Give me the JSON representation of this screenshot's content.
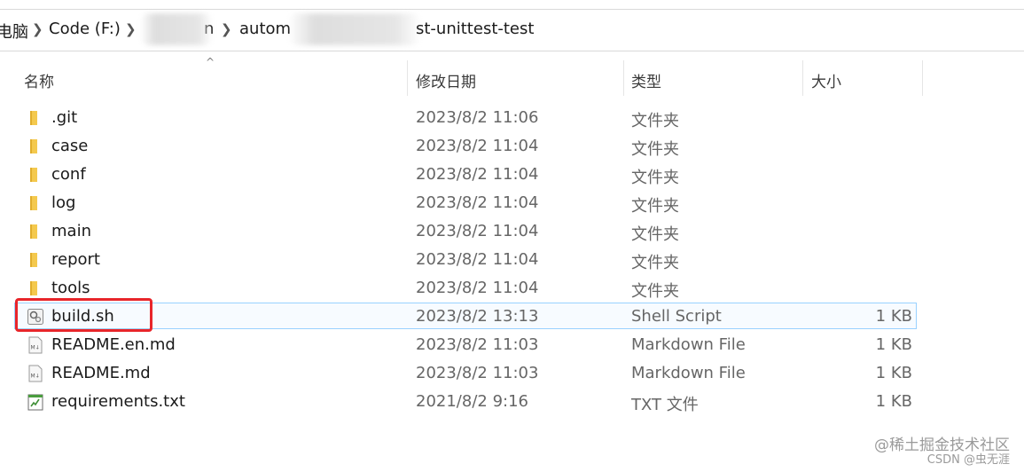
{
  "breadcrumb": {
    "items": [
      "电脑",
      "Code (F:)",
      "n",
      "autom",
      "st-unittest-test"
    ]
  },
  "columns": {
    "name": "名称",
    "date": "修改日期",
    "type": "类型",
    "size": "大小"
  },
  "files": [
    {
      "name": ".git",
      "date": "2023/8/2 11:06",
      "type": "文件夹",
      "size": "",
      "icon": "folder-icon"
    },
    {
      "name": "case",
      "date": "2023/8/2 11:04",
      "type": "文件夹",
      "size": "",
      "icon": "folder-icon"
    },
    {
      "name": "conf",
      "date": "2023/8/2 11:04",
      "type": "文件夹",
      "size": "",
      "icon": "folder-icon"
    },
    {
      "name": "log",
      "date": "2023/8/2 11:04",
      "type": "文件夹",
      "size": "",
      "icon": "folder-icon"
    },
    {
      "name": "main",
      "date": "2023/8/2 11:04",
      "type": "文件夹",
      "size": "",
      "icon": "folder-icon"
    },
    {
      "name": "report",
      "date": "2023/8/2 11:04",
      "type": "文件夹",
      "size": "",
      "icon": "folder-icon"
    },
    {
      "name": "tools",
      "date": "2023/8/2 11:04",
      "type": "文件夹",
      "size": "",
      "icon": "folder-icon"
    },
    {
      "name": "build.sh",
      "date": "2023/8/2 13:13",
      "type": "Shell Script",
      "size": "1 KB",
      "icon": "shell-script-icon"
    },
    {
      "name": "README.en.md",
      "date": "2023/8/2 11:03",
      "type": "Markdown File",
      "size": "1 KB",
      "icon": "markdown-file-icon"
    },
    {
      "name": "README.md",
      "date": "2023/8/2 11:03",
      "type": "Markdown File",
      "size": "1 KB",
      "icon": "markdown-file-icon"
    },
    {
      "name": "requirements.txt",
      "date": "2021/8/2 9:16",
      "type": "TXT 文件",
      "size": "1 KB",
      "icon": "text-file-icon"
    }
  ],
  "watermark": {
    "line1": "@稀土掘金技术社区",
    "line2": "CSDN @虫无涯"
  },
  "colors": {
    "folder": "#f4c94e",
    "selection_border": "#99d1ff",
    "highlight_box": "#e8252a"
  }
}
